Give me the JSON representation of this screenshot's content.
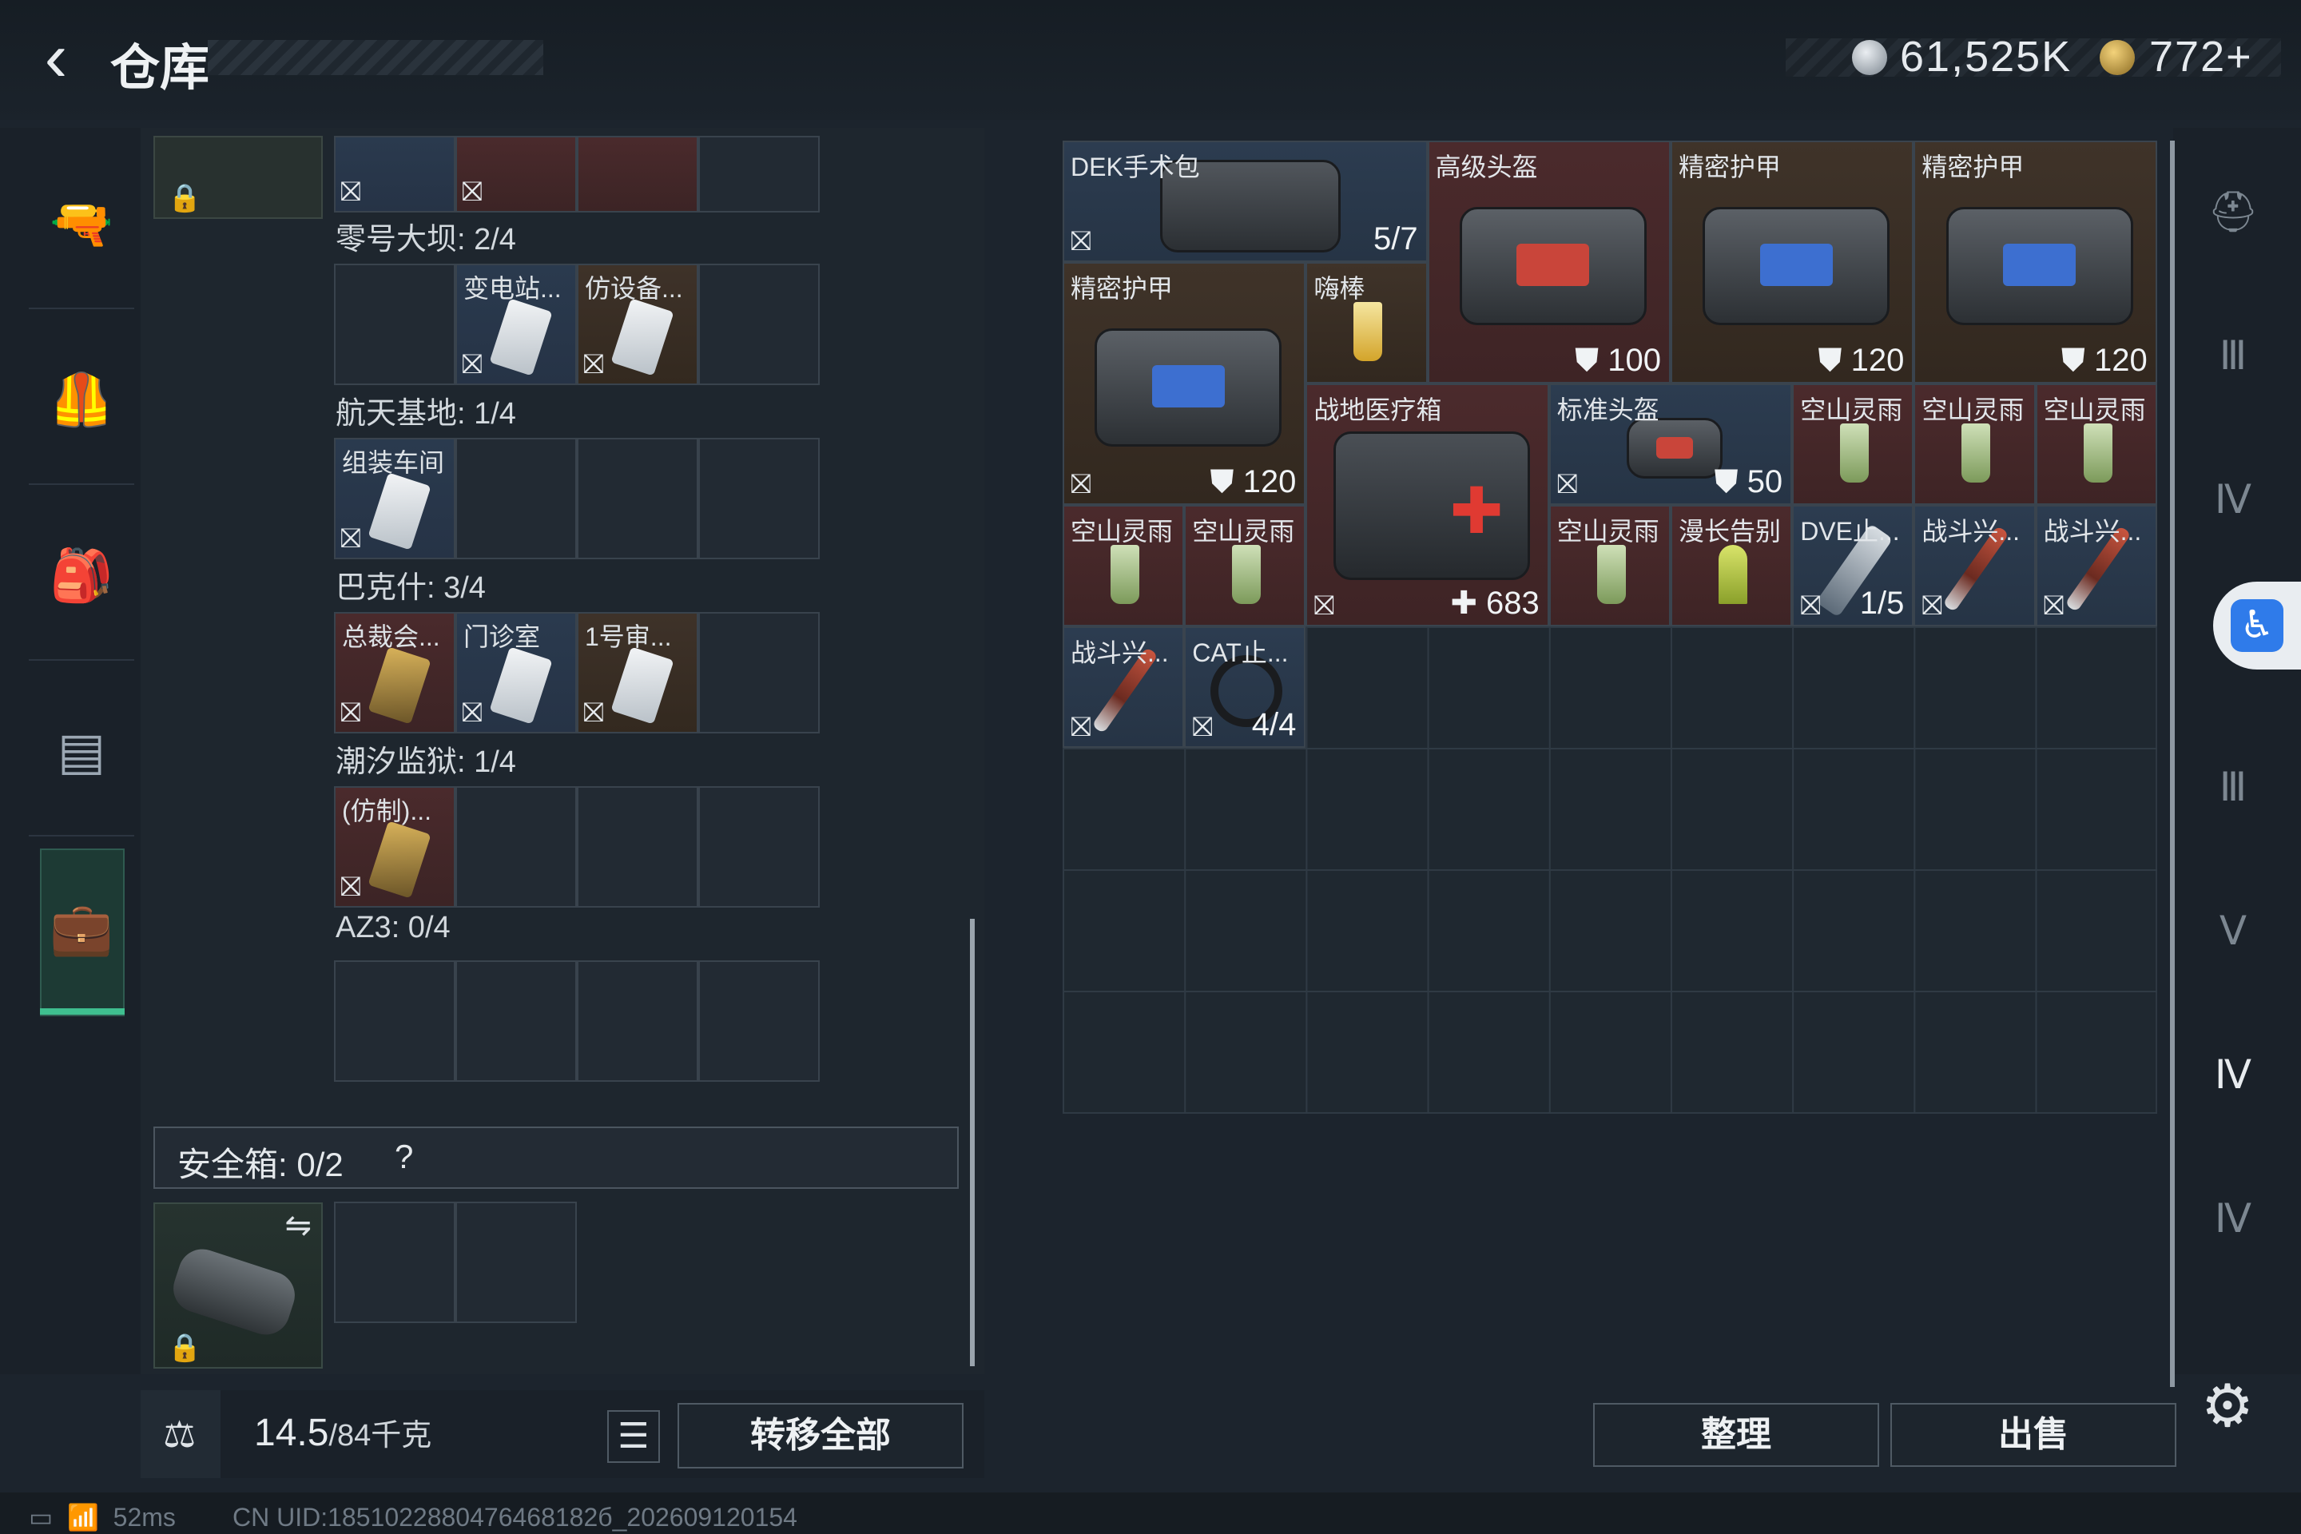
{
  "header": {
    "title": "仓库",
    "currency1_icon": "silver-coin-icon",
    "currency1": "61,525K",
    "currency2_icon": "gold-triangle-coin-icon",
    "currency2": "772+"
  },
  "left_nav": [
    {
      "icon": "gun-icon",
      "glyph": "🔫"
    },
    {
      "icon": "armor-vest-icon",
      "glyph": "🦺"
    },
    {
      "icon": "backpack-icon",
      "glyph": "🎒"
    },
    {
      "icon": "chest-rig-icon",
      "glyph": "▤"
    },
    {
      "icon": "toolbox-icon",
      "glyph": "💼"
    }
  ],
  "maps": [
    {
      "label": "零号大坝: 2/4",
      "cells": [
        {
          "name": "",
          "color": "",
          "card": ""
        },
        {
          "name": "变电站...",
          "color": "blue",
          "card": "white"
        },
        {
          "name": "仿设备...",
          "color": "brown",
          "card": "white"
        },
        {
          "name": "",
          "color": "",
          "card": ""
        }
      ]
    },
    {
      "label": "航天基地: 1/4",
      "cells": [
        {
          "name": "组装车间",
          "color": "blue",
          "card": "white"
        },
        {
          "name": "",
          "color": "",
          "card": ""
        },
        {
          "name": "",
          "color": "",
          "card": ""
        },
        {
          "name": "",
          "color": "",
          "card": ""
        }
      ]
    },
    {
      "label": "巴克什: 3/4",
      "cells": [
        {
          "name": "总裁会...",
          "color": "red",
          "card": "gold"
        },
        {
          "name": "门诊室",
          "color": "blue",
          "card": "white"
        },
        {
          "name": "1号审...",
          "color": "brown",
          "card": "white"
        },
        {
          "name": "",
          "color": "",
          "card": ""
        }
      ]
    },
    {
      "label": "潮汐监狱: 1/4",
      "cells": [
        {
          "name": "(仿制)...",
          "color": "red",
          "card": "gold"
        },
        {
          "name": "",
          "color": "",
          "card": ""
        },
        {
          "name": "",
          "color": "",
          "card": ""
        },
        {
          "name": "",
          "color": "",
          "card": ""
        }
      ]
    },
    {
      "label": "AZ3: 0/4",
      "cells": [
        {
          "name": "",
          "color": "",
          "card": ""
        },
        {
          "name": "",
          "color": "",
          "card": ""
        },
        {
          "name": "",
          "color": "",
          "card": ""
        },
        {
          "name": "",
          "color": "",
          "card": ""
        }
      ]
    }
  ],
  "safebox": {
    "label": "安全箱: 0/2",
    "help": "?"
  },
  "bottom_left": {
    "weight_current": "14.5",
    "weight_max": "/84千克",
    "transfer_all": "转移全部"
  },
  "stash_items": [
    {
      "name": "DEK手术包",
      "value": "5/7",
      "color": "blue",
      "kind": "surgery"
    },
    {
      "name": "高级头盔",
      "value": "100",
      "color": "red",
      "kind": "helmet"
    },
    {
      "name": "精密护甲",
      "value": "120",
      "color": "brown",
      "kind": "armor"
    },
    {
      "name": "精密护甲",
      "value": "120",
      "color": "brown",
      "kind": "armor"
    },
    {
      "name": "精密护甲",
      "value": "120",
      "color": "brown",
      "kind": "armor"
    },
    {
      "name": "嗨棒",
      "value": "",
      "color": "brown",
      "kind": "drink"
    },
    {
      "name": "战地医疗箱",
      "value": "683",
      "color": "red",
      "kind": "medkit"
    },
    {
      "name": "标准头盔",
      "value": "50",
      "color": "blue",
      "kind": "helmet"
    },
    {
      "name": "空山灵雨",
      "value": "",
      "color": "red",
      "kind": "drink"
    },
    {
      "name": "空山灵雨",
      "value": "",
      "color": "red",
      "kind": "drink"
    },
    {
      "name": "空山灵雨",
      "value": "",
      "color": "red",
      "kind": "drink"
    },
    {
      "name": "空山灵雨",
      "value": "",
      "color": "red",
      "kind": "drink"
    },
    {
      "name": "空山灵雨",
      "value": "",
      "color": "red",
      "kind": "drink"
    },
    {
      "name": "空山灵雨",
      "value": "",
      "color": "red",
      "kind": "drink"
    },
    {
      "name": "漫长告别",
      "value": "",
      "color": "red",
      "kind": "drink"
    },
    {
      "name": "DVE止...",
      "value": "1/5",
      "color": "blue",
      "kind": "spray"
    },
    {
      "name": "战斗兴...",
      "value": "",
      "color": "blue",
      "kind": "injector"
    },
    {
      "name": "战斗兴...",
      "value": "",
      "color": "blue",
      "kind": "injector"
    },
    {
      "name": "战斗兴...",
      "value": "",
      "color": "blue",
      "kind": "injector"
    },
    {
      "name": "CAT止...",
      "value": "4/4",
      "color": "blue",
      "kind": "tourniquet"
    }
  ],
  "right_nav": [
    {
      "icon": "helmet-icon",
      "glyph": "⛑"
    },
    {
      "icon": "tier3-weapon-icon",
      "glyph": "Ⅲ"
    },
    {
      "icon": "tier4-folder-icon",
      "glyph": "Ⅳ"
    },
    {
      "icon": "tier3-box-icon",
      "glyph": "Ⅲ"
    },
    {
      "icon": "tier5-camera-icon",
      "glyph": "Ⅴ"
    },
    {
      "icon": "tier4-medical-icon",
      "glyph": "Ⅳ"
    },
    {
      "icon": "tier4-camera-icon",
      "glyph": "Ⅳ"
    }
  ],
  "buttons": {
    "sort": "整理",
    "sell": "出售"
  },
  "status_bar": {
    "ping": "52ms",
    "uid": "CN UID:1851022880476468182б_202609120154"
  }
}
